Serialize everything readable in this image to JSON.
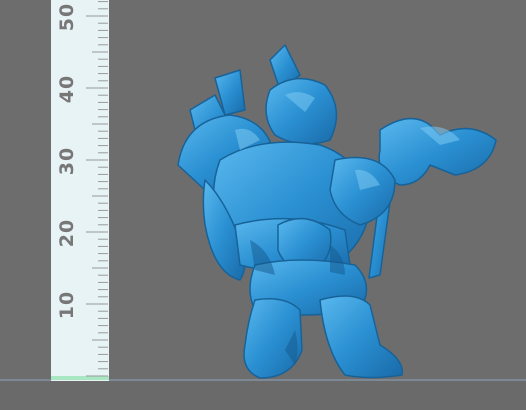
{
  "scene": {
    "subject": "miniature-figure",
    "subject_color": "#2a90d2",
    "background_color": "#6d6d6d",
    "ruler_color": "#e8f3f6"
  },
  "ruler": {
    "labels": [
      "50",
      "40",
      "30",
      "20",
      "10"
    ]
  }
}
